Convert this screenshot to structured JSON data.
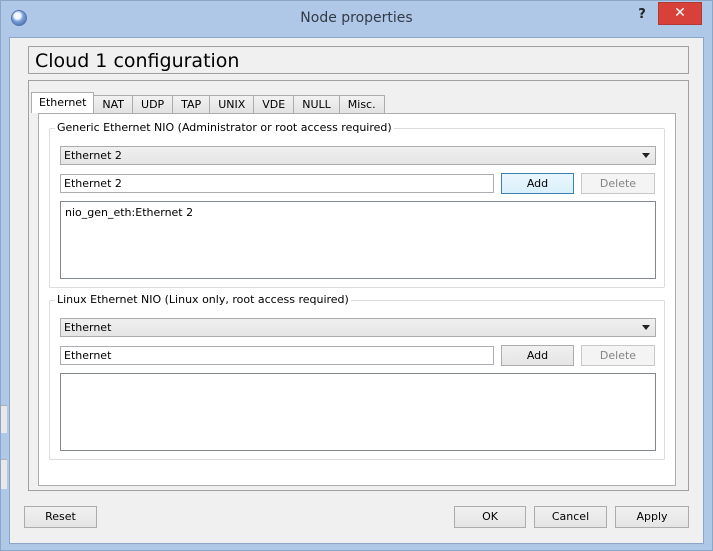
{
  "window": {
    "title": "Node properties",
    "help_label": "?",
    "close_label": "✕",
    "app_icon": "gns3-app-icon"
  },
  "header": {
    "title": "Cloud 1 configuration"
  },
  "tabs": [
    {
      "label": "Ethernet",
      "active": true
    },
    {
      "label": "NAT"
    },
    {
      "label": "UDP"
    },
    {
      "label": "TAP"
    },
    {
      "label": "UNIX"
    },
    {
      "label": "VDE"
    },
    {
      "label": "NULL"
    },
    {
      "label": "Misc."
    }
  ],
  "generic_group": {
    "title": "Generic Ethernet NIO (Administrator or root access required)",
    "combo_value": "Ethernet 2",
    "field_value": "Ethernet 2",
    "add_label": "Add",
    "delete_label": "Delete",
    "list_items": [
      "nio_gen_eth:Ethernet 2"
    ]
  },
  "linux_group": {
    "title": "Linux Ethernet NIO (Linux only, root access required)",
    "combo_value": "Ethernet",
    "field_value": "Ethernet",
    "add_label": "Add",
    "delete_label": "Delete",
    "list_items": []
  },
  "footer": {
    "reset_label": "Reset",
    "ok_label": "OK",
    "cancel_label": "Cancel",
    "apply_label": "Apply"
  },
  "colors": {
    "titlebar": "#afc8e8",
    "close_button": "#d8413a",
    "dialog_bg": "#f0f0f0"
  }
}
